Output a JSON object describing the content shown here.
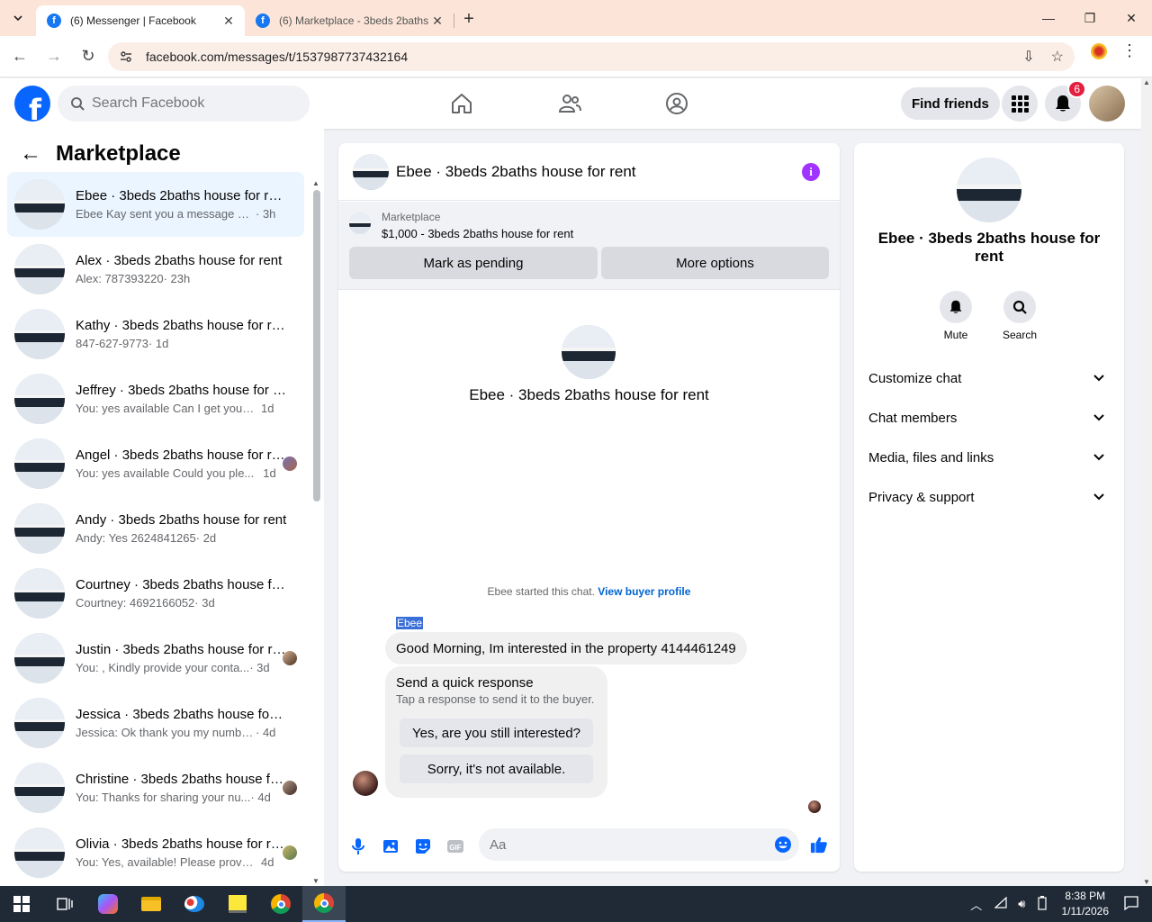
{
  "browser": {
    "tabs": [
      {
        "title": "(6) Messenger | Facebook",
        "active": true
      },
      {
        "title": "(6) Marketplace - 3beds 2baths",
        "active": false
      }
    ],
    "url": "facebook.com/messages/t/1537987737432164"
  },
  "fb_header": {
    "search_placeholder": "Search Facebook",
    "find_friends": "Find friends",
    "notification_count": "6"
  },
  "sidebar": {
    "title": "Marketplace",
    "conversations": [
      {
        "name": "Ebee · 3beds 2baths house for rent",
        "snippet": "Ebee Kay sent you a message abou...",
        "time": "· 3h"
      },
      {
        "name": "Alex · 3beds 2baths house for rent",
        "snippet": "Alex: 787393220",
        "time": "· 23h"
      },
      {
        "name": "Kathy · 3beds 2baths house for rent",
        "snippet": "847-627-9773",
        "time": "· 1d"
      },
      {
        "name": "Jeffrey · 3beds 2baths house for rent",
        "snippet": "You: yes available Can I get your nu...",
        "time": "1d"
      },
      {
        "name": "Angel · 3beds 2baths house for rent",
        "snippet": "You: yes available Could you ple...",
        "time": "1d"
      },
      {
        "name": "Andy · 3beds 2baths house for rent",
        "snippet": "Andy: Yes 2624841265",
        "time": "· 2d"
      },
      {
        "name": "Courtney · 3beds 2baths house for rent",
        "snippet": "Courtney: 4692166052",
        "time": "· 3d"
      },
      {
        "name": "Justin · 3beds 2baths house for rent",
        "snippet": "You: , Kindly provide your conta...",
        "time": "· 3d"
      },
      {
        "name": "Jessica · 3beds 2baths house for rent",
        "snippet": "Jessica: Ok thank you my number i...",
        "time": "· 4d"
      },
      {
        "name": "Christine · 3beds 2baths house for rent",
        "snippet": "You: Thanks for sharing your nu...",
        "time": "· 4d"
      },
      {
        "name": "Olivia · 3beds 2baths house for rent",
        "snippet": "You: Yes, available! Please provid...",
        "time": "4d"
      }
    ]
  },
  "chat": {
    "title": "Ebee · 3beds 2baths house for rent",
    "marketplace_label": "Marketplace",
    "listing": "$1,000 - 3beds 2baths house for rent",
    "mark_pending": "Mark as pending",
    "more_options": "More options",
    "intro_name": "Ebee · 3beds 2baths house for rent",
    "started_text": "Ebee started this chat.",
    "buyer_profile_link": "View buyer profile",
    "sender": "Ebee",
    "message": "Good Morning, Im interested in the property 4144461249",
    "quick_title": "Send a quick response",
    "quick_sub": "Tap a response to send it to the buyer.",
    "quick_1": "Yes, are you still interested?",
    "quick_2": "Sorry, it's not available.",
    "input_placeholder": "Aa"
  },
  "right_panel": {
    "name": "Ebee · 3beds 2baths house for rent",
    "mute": "Mute",
    "search": "Search",
    "rows": [
      "Customize chat",
      "Chat members",
      "Media, files and links",
      "Privacy & support"
    ]
  },
  "taskbar": {
    "time": "8:38 PM",
    "date": "1/11/2026"
  },
  "colors": {
    "fb_blue": "#0866ff",
    "accent_purple": "#a033ff",
    "selected_bg": "#ebf5ff"
  }
}
